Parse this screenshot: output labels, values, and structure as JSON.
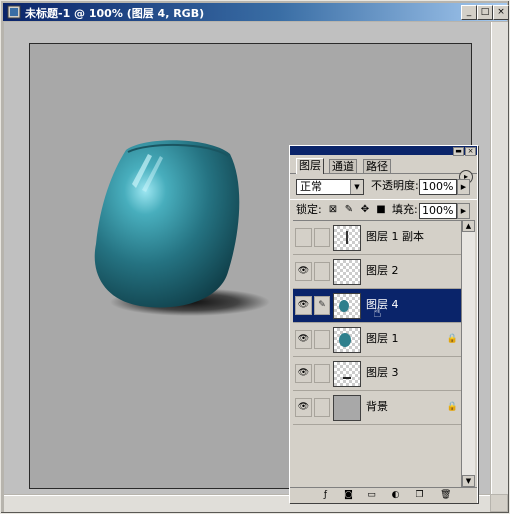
{
  "window": {
    "title": "未标题-1 @ 100% (图层 4, RGB)",
    "buttons": {
      "minimize": "_",
      "maximize": "□",
      "close": "×"
    }
  },
  "palette": {
    "tabs": [
      {
        "label": "图层",
        "active": true
      },
      {
        "label": "通道",
        "active": false
      },
      {
        "label": "路径",
        "active": false
      }
    ],
    "menu_glyph": "▸",
    "blend_mode": "正常",
    "opacity_label": "不透明度:",
    "opacity_value": "100%",
    "lock_label": "锁定:",
    "fill_label": "填充:",
    "fill_value": "100%",
    "layers": [
      {
        "name": "图层 1 副本",
        "visible": false,
        "selected": false,
        "locked": false,
        "thumb": "line"
      },
      {
        "name": "图层 2",
        "visible": true,
        "selected": false,
        "locked": false,
        "thumb": "empty"
      },
      {
        "name": "图层 4",
        "visible": true,
        "selected": true,
        "locked": false,
        "thumb": "blob"
      },
      {
        "name": "图层 1",
        "visible": true,
        "selected": false,
        "locked": true,
        "thumb": "blob"
      },
      {
        "name": "图层 3",
        "visible": true,
        "selected": false,
        "locked": false,
        "thumb": "dash"
      },
      {
        "name": "背景",
        "visible": true,
        "selected": false,
        "locked": true,
        "thumb": "gray"
      }
    ]
  },
  "colors": {
    "titlebar": "#0a246a",
    "selection": "#0a246a",
    "vase": "#2e7f8c",
    "canvas": "#a8a8a8"
  }
}
